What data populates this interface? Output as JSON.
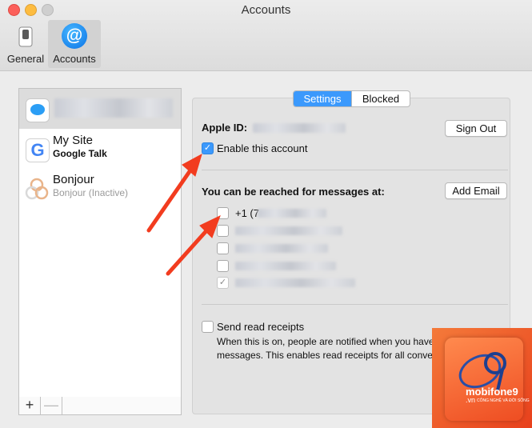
{
  "window": {
    "title": "Accounts"
  },
  "toolbar": {
    "general_label": "General",
    "accounts_label": "Accounts",
    "general_icon": "switch-icon",
    "accounts_icon": "at-sign-icon"
  },
  "sidebar": {
    "accounts": [
      {
        "name": "",
        "type": "",
        "icon": "messages-icon",
        "selected": true,
        "blurred": true
      },
      {
        "name": "My Site",
        "type": "Google Talk",
        "icon": "google-icon",
        "selected": false
      },
      {
        "name": "Bonjour",
        "type": "Bonjour (Inactive)",
        "icon": "bonjour-icon",
        "selected": false
      }
    ],
    "add_label": "+",
    "remove_label": "—"
  },
  "tabs": [
    {
      "label": "Settings",
      "active": true
    },
    {
      "label": "Blocked",
      "active": false
    }
  ],
  "settings": {
    "apple_id_label": "Apple ID:",
    "sign_out_label": "Sign Out",
    "enable_label": "Enable this account",
    "enable_checked": true,
    "reach_label": "You can be reached for messages at:",
    "add_email_label": "Add Email",
    "addresses": [
      {
        "text": "+1 (7",
        "checked": false
      },
      {
        "text": "",
        "checked": false
      },
      {
        "text": "",
        "checked": false
      },
      {
        "text": "",
        "checked": false
      },
      {
        "text": "",
        "checked": true,
        "disabled": true
      }
    ],
    "read_receipts_label": "Send read receipts",
    "read_receipts_checked": false,
    "read_receipts_description": "When this is on, people are notified when you have read their messages. This enables read receipts for all conversations."
  },
  "watermark": {
    "brand": "mobifone9",
    "domain": ".vn",
    "tagline": "CÔNG NGHỆ VÀ ĐỜI SỐNG"
  },
  "colors": {
    "accent": "#3b99fc",
    "arrow": "#f23c1f",
    "watermark": "#ee4d22"
  }
}
